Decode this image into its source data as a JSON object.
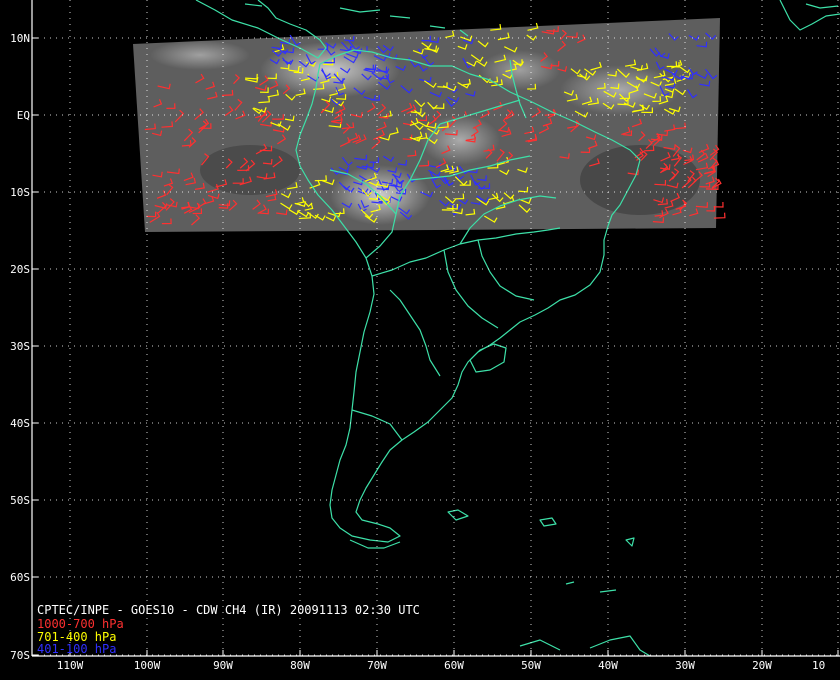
{
  "title": "CPTEC/INPE - GOES10 - CDW CH4 (IR) 20091113 02:30 UTC",
  "legend": [
    {
      "label": "1000-700 hPa",
      "color": "#ff3030"
    },
    {
      "label": "701-400 hPa",
      "color": "#ffff00"
    },
    {
      "label": "401-100 hPa",
      "color": "#3030ff"
    }
  ],
  "lat_labels": [
    "10N",
    "EQ",
    "10S",
    "20S",
    "30S",
    "40S",
    "50S",
    "60S",
    "70S"
  ],
  "lon_labels": [
    "110W",
    "100W",
    "90W",
    "80W",
    "70W",
    "60W",
    "50W",
    "40W",
    "30W",
    "20W",
    "10"
  ],
  "colors": {
    "coastline": "#3de0a8",
    "grid": "#ffffff",
    "background": "#000000",
    "cloud_band": "#5a5a5a"
  }
}
